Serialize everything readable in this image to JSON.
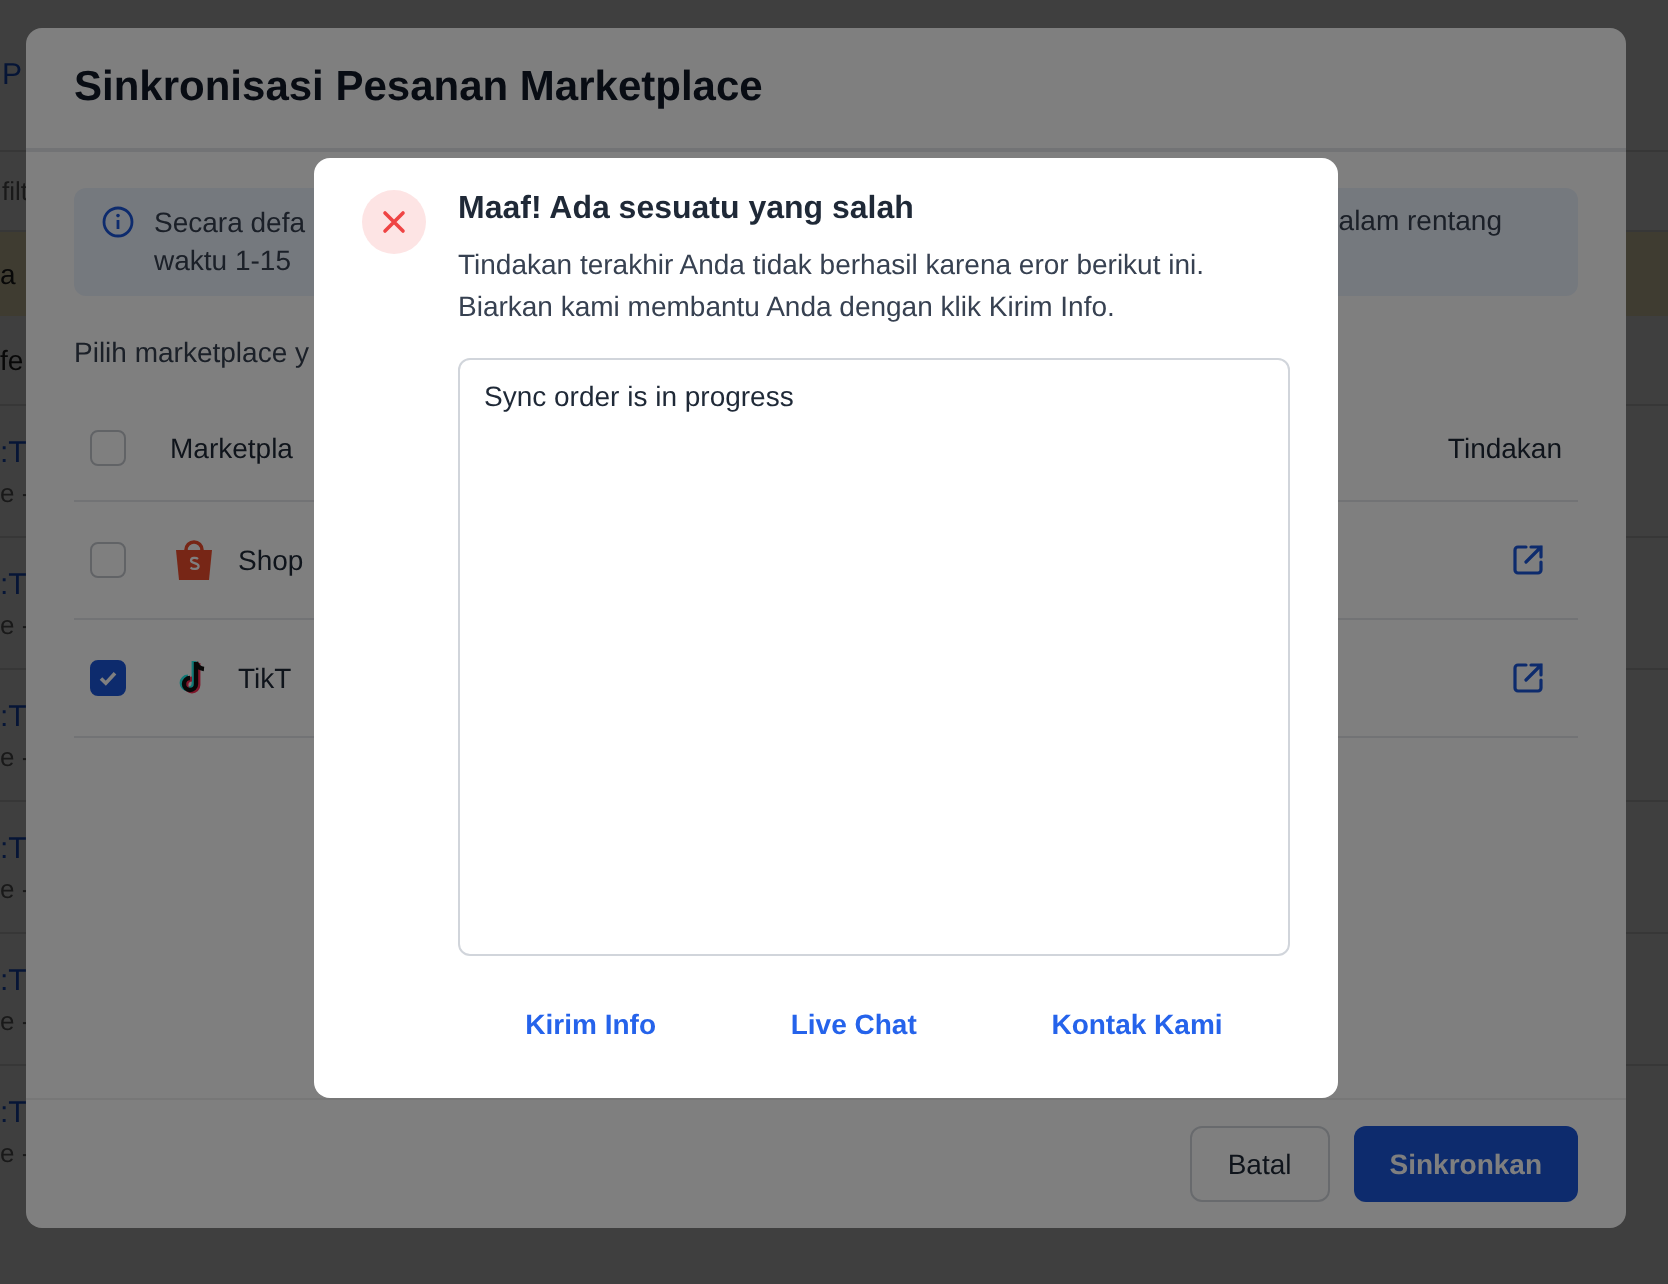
{
  "background_page": {
    "header": {
      "text": "P"
    },
    "filter": {
      "text": "filt"
    },
    "notice": {
      "text": "a"
    },
    "label": {
      "text": "fe"
    },
    "orders": [
      {
        "id": ":T",
        "meta": "e -"
      },
      {
        "id": ":T",
        "meta": "e -"
      },
      {
        "id": ":T",
        "meta": "e -"
      },
      {
        "id": ":T",
        "meta": "e -"
      },
      {
        "id": ":T",
        "meta": "e -"
      },
      {
        "id": ":T",
        "meta": "e -"
      }
    ]
  },
  "sync_dialog": {
    "title": "Sinkronisasi Pesanan Marketplace",
    "info_banner": {
      "line_1_start": "Secara defa",
      "line_1_end": "alam rentang",
      "line_2_start": "waktu 1-15"
    },
    "instruction": "Pilih marketplace y",
    "table": {
      "columns": [
        "Marketpla",
        "Tindakan"
      ],
      "header_checked": false,
      "rows": [
        {
          "kind": "shopee",
          "name": "Shop",
          "checked": false
        },
        {
          "kind": "tiktok",
          "name": "TikT",
          "checked": true
        }
      ]
    },
    "buttons": [
      {
        "label": "Batal",
        "kind": "secondary"
      },
      {
        "label": "Sinkronkan",
        "kind": "primary"
      }
    ]
  },
  "error_dialog": {
    "title": "Maaf! Ada sesuatu yang salah",
    "message_lines": [
      "Tindakan terakhir Anda tidak berhasil karena eror berikut ini.",
      "Biarkan kami membantu Anda dengan klik Kirim Info."
    ],
    "details": "Sync order is in progress",
    "links": [
      "Kirim Info",
      "Live Chat",
      "Kontak Kami"
    ]
  }
}
